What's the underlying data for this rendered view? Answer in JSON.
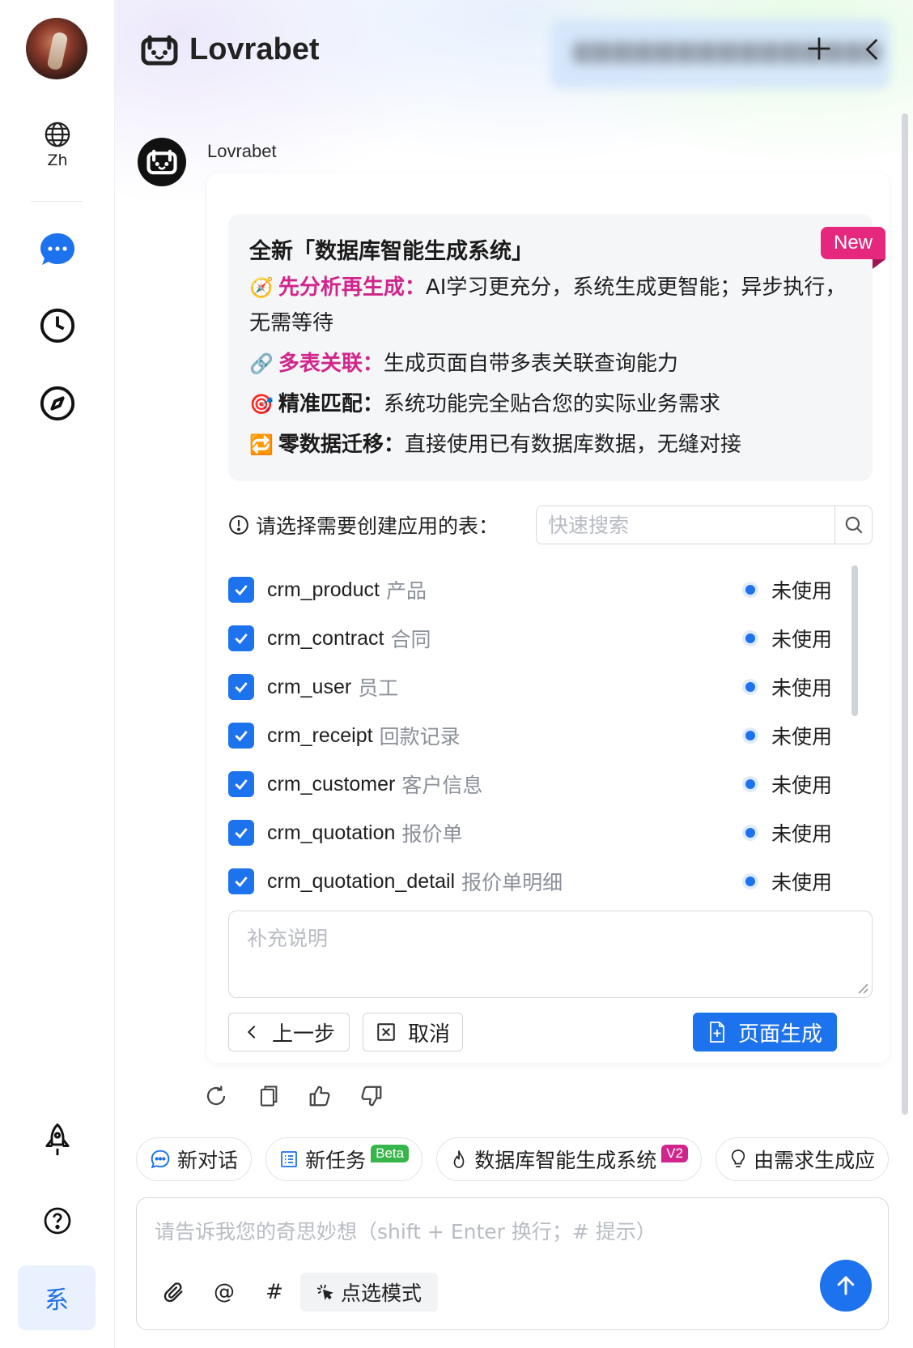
{
  "sidebar": {
    "language": "Zh",
    "system_label": "系"
  },
  "header": {
    "brand": "Lovrabet"
  },
  "bot": {
    "name": "Lovrabet"
  },
  "feature": {
    "title": "全新「数据库智能生成系统」",
    "badge": "New",
    "items": [
      {
        "emoji": "🧭",
        "label": "先分析再生成：",
        "text": "AI学习更充分，系统生成更智能；异步执行，无需等待"
      },
      {
        "emoji": "🔗",
        "label": "多表关联：",
        "text": "生成页面自带多表关联查询能力"
      },
      {
        "emoji": "🎯",
        "label": "精准匹配：",
        "text": "系统功能完全贴合您的实际业务需求"
      },
      {
        "emoji": "🔁",
        "label": "零数据迁移：",
        "text": "直接使用已有数据库数据，无缝对接"
      }
    ]
  },
  "table_select": {
    "label": "请选择需要创建应用的表：",
    "search_placeholder": "快速搜索",
    "rows": [
      {
        "name": "crm_product",
        "label": "产品",
        "status": "未使用"
      },
      {
        "name": "crm_contract",
        "label": "合同",
        "status": "未使用"
      },
      {
        "name": "crm_user",
        "label": "员工",
        "status": "未使用"
      },
      {
        "name": "crm_receipt",
        "label": "回款记录",
        "status": "未使用"
      },
      {
        "name": "crm_customer",
        "label": "客户信息",
        "status": "未使用"
      },
      {
        "name": "crm_quotation",
        "label": "报价单",
        "status": "未使用"
      },
      {
        "name": "crm_quotation_detail",
        "label": "报价单明细",
        "status": "未使用"
      }
    ]
  },
  "note": {
    "placeholder": "补充说明"
  },
  "buttons": {
    "prev": "上一步",
    "cancel": "取消",
    "generate": "页面生成"
  },
  "chips": {
    "new_chat": "新对话",
    "new_task": "新任务",
    "new_task_tag": "Beta",
    "db_system": "数据库智能生成系统",
    "db_system_tag": "V2",
    "from_req": "由需求生成应"
  },
  "composer": {
    "placeholder": "请告诉我您的奇思妙想（shift + Enter 换行；# 提示）",
    "at": "@",
    "hash": "#",
    "pick_mode": "点选模式"
  },
  "colors": {
    "primary": "#1d72ee",
    "accent": "#d0268b",
    "badge": "#e5277e"
  }
}
